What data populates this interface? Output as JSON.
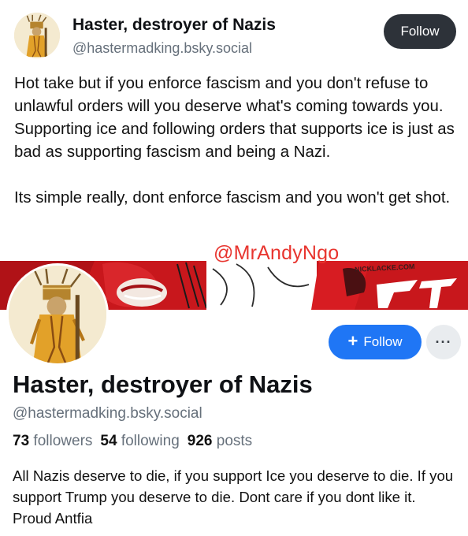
{
  "post": {
    "author_name": "Haster, destroyer of Nazis",
    "author_handle": "@hastermadking.bsky.social",
    "follow_label": "Follow",
    "paragraphs": [
      "Hot take but if you enforce fascism and you don't refuse to unlawful orders will you deserve what's coming towards you. Supporting ice and following orders that supports ice is just as bad as supporting fascism and being a Nazi.",
      "Its simple really, dont enforce fascism and you won't get shot."
    ]
  },
  "watermark": "@MrAndyNgo",
  "profile": {
    "banner_credit": "NICKLACKE.COM",
    "follow_label": "Follow",
    "more_label": "···",
    "name": "Haster, destroyer of Nazis",
    "handle": "@hastermadking.bsky.social",
    "stats": {
      "followers_count": "73",
      "followers_label": "followers",
      "following_count": "54",
      "following_label": "following",
      "posts_count": "926",
      "posts_label": "posts"
    },
    "bio": "All Nazis deserve to die, if you support Ice you deserve to die. If you support Trump you deserve to die. Dont care if you dont like it. Proud Antfia"
  },
  "colors": {
    "follow_dark": "#2d3239",
    "follow_blue": "#1f76f5",
    "banner_red": "#c8171c",
    "watermark_red": "#e8352f",
    "muted_text": "#66707b"
  },
  "icons": {
    "plus": "plus-icon",
    "more": "more-options-icon"
  }
}
